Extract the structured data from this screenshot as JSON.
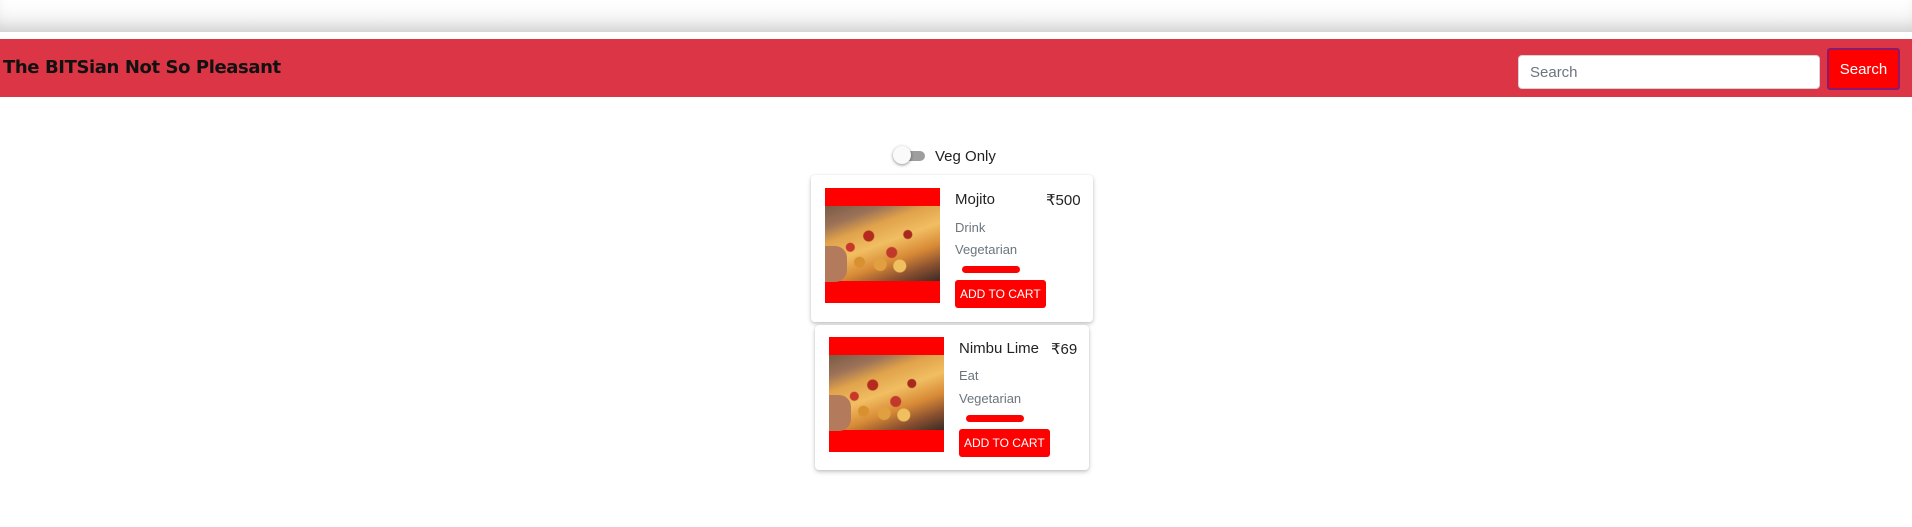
{
  "navbar": {
    "brand": "The BITSian Not So Pleasant",
    "search_placeholder": "Search",
    "search_value": "",
    "search_button": "Search"
  },
  "filter": {
    "veg_only_label": "Veg Only",
    "veg_only_checked": false
  },
  "items": [
    {
      "name": "Mojito",
      "currency": "₹",
      "price": "500",
      "category": "Drink",
      "diet": "Vegetarian",
      "add_to_cart": "ADD TO CART"
    },
    {
      "name": "Nimbu Lime",
      "currency": "₹",
      "price": "69",
      "category": "Eat",
      "diet": "Vegetarian",
      "add_to_cart": "ADD TO CART"
    }
  ],
  "colors": {
    "navbar": "#dc3545",
    "button": "#ff0000",
    "image_background": "#ff0000"
  }
}
